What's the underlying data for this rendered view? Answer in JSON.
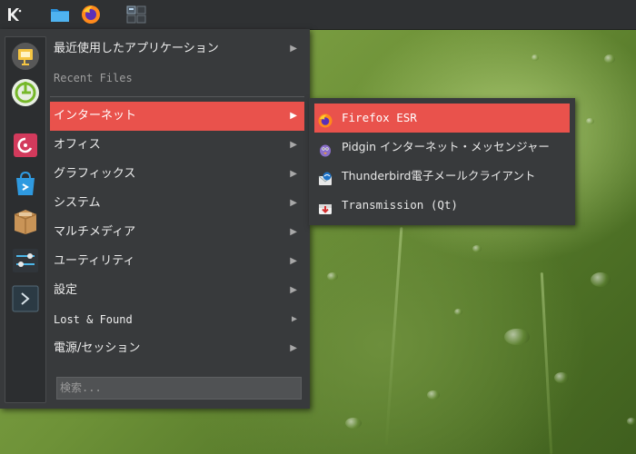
{
  "panel": {
    "items": [
      {
        "name": "kde-launcher-icon"
      },
      {
        "name": "file-manager-icon"
      },
      {
        "name": "firefox-icon"
      },
      {
        "name": "pager-icon"
      }
    ]
  },
  "favorites": [
    {
      "name": "presentation-app-icon"
    },
    {
      "name": "power-ring-icon"
    },
    {
      "name": "debian-package-icon"
    },
    {
      "name": "software-store-icon"
    },
    {
      "name": "archive-box-icon"
    },
    {
      "name": "system-settings-icon"
    },
    {
      "name": "terminal-icon"
    }
  ],
  "menu": {
    "recent_apps": "最近使用したアプリケーション",
    "recent_files": "Recent Files",
    "categories": [
      "インターネット",
      "オフィス",
      "グラフィックス",
      "システム",
      "マルチメディア",
      "ユーティリティ",
      "設定",
      "Lost & Found",
      "電源/セッション"
    ],
    "arrow": "▶",
    "search_placeholder": "検索..."
  },
  "submenu": {
    "items": [
      {
        "label": "Firefox ESR",
        "icon": "firefox-icon"
      },
      {
        "label": "Pidgin インターネット・メッセンジャー",
        "icon": "pidgin-icon"
      },
      {
        "label": "Thunderbird電子メールクライアント",
        "icon": "thunderbird-icon"
      },
      {
        "label": "Transmission (Qt)",
        "icon": "transmission-icon"
      }
    ]
  },
  "colors": {
    "accent": "#e9524c",
    "menu_bg": "#383a3c",
    "panel_bg": "#2f3133"
  }
}
